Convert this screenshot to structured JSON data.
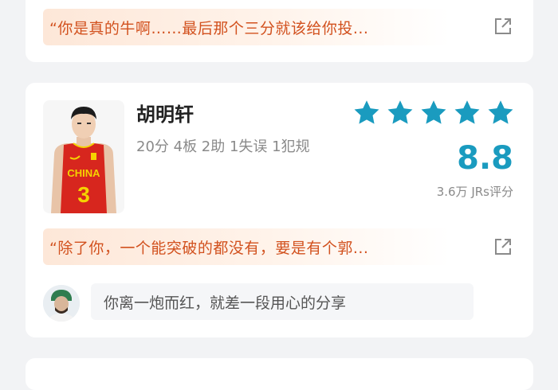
{
  "top_card": {
    "quote": "“你是真的牛啊……最后那个三分就该给你投..."
  },
  "player": {
    "name": "胡明轩",
    "jersey_text": "CHINA",
    "jersey_number": "3",
    "stats": "20分 4板 2助 1失误 1犯规",
    "rating": "8.8",
    "star_count": 5,
    "rating_count": "3.6万 JRs评分",
    "quote": "“除了你，一个能突破的都没有，要是有个郭...",
    "comment_placeholder": "你离一炮而红，就差一段用心的分享"
  },
  "colors": {
    "accent": "#1a9bbf",
    "quote_text": "#d2511e",
    "jersey_red": "#d7261e",
    "jersey_yellow": "#f5d300"
  },
  "icons": {
    "share": "share-external-icon",
    "star": "star-icon"
  }
}
